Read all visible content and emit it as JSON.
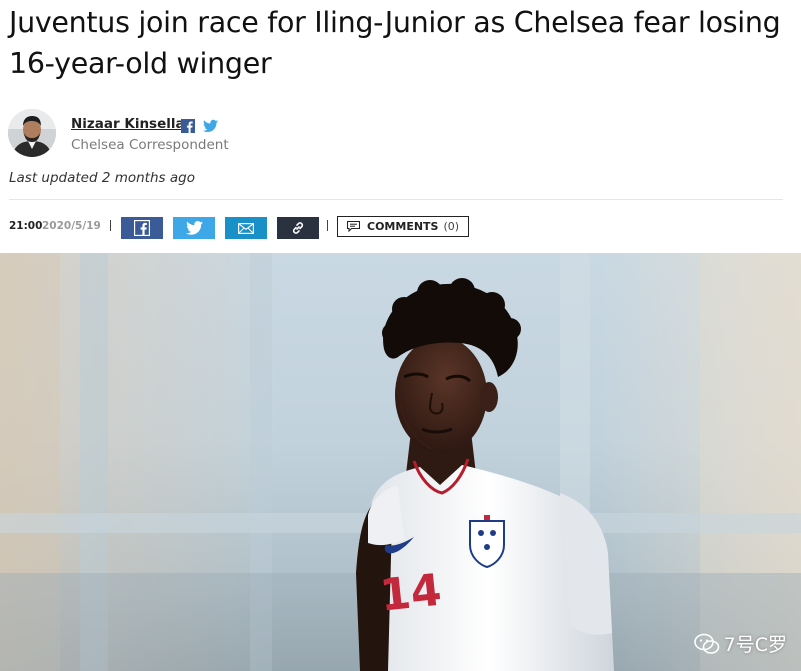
{
  "article": {
    "headline_line1": "Juventus join race for Iling-Junior as Chelsea fear losing",
    "headline_line2": "16-year-old winger",
    "author": {
      "name": "Nizaar Kinsella",
      "role": "Chelsea Correspondent",
      "social_icons": [
        "facebook-icon",
        "twitter-icon"
      ]
    },
    "last_updated": "Last updated 2 months ago",
    "time": "21:00",
    "date": "2020/5/19",
    "share": {
      "buttons": [
        "facebook",
        "twitter",
        "email",
        "link"
      ]
    },
    "comments": {
      "label": "COMMENTS",
      "count": "(0)"
    }
  },
  "hero_image": {
    "shirt_number": "14",
    "watermark": "7号C罗"
  },
  "colors": {
    "facebook": "#3b5b98",
    "twitter": "#3ea7e8",
    "email": "#1a90c9",
    "link": "#2a3240",
    "date": "#9a9a9a",
    "role": "#7a7a7a"
  }
}
